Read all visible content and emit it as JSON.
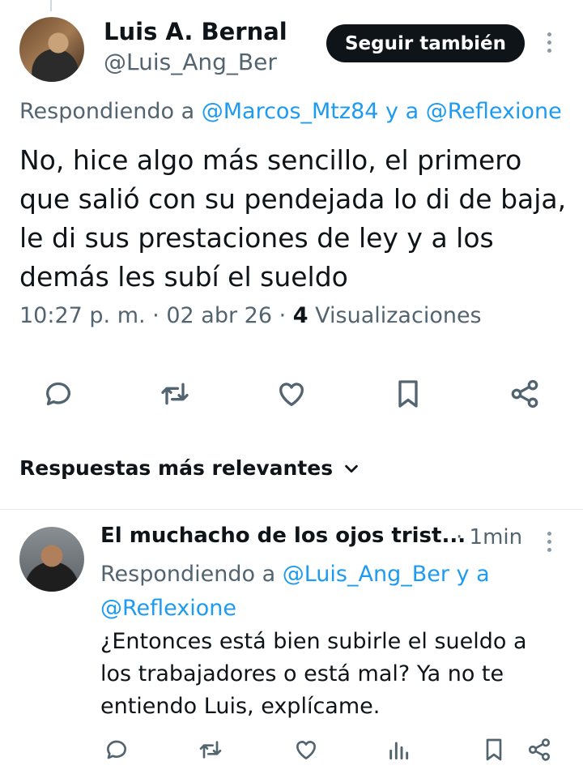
{
  "tweet": {
    "author_name": "Luis A. Bernal",
    "author_handle": "@Luis_Ang_Ber",
    "follow_label": "Seguir también",
    "replying_prefix": "Respondiendo a ",
    "replying_user1": "@Marcos_Mtz84",
    "replying_joiner": " y a ",
    "replying_user2": "@Reflexione",
    "text": "No, hice algo más sencillo, el primero que salió con su pendejada lo di de baja, le di sus prestaciones de ley y a los demás les subí el sueldo",
    "time": "10:27 p. m.",
    "date": "02 abr 26",
    "separator": " · ",
    "views_count": "4",
    "views_label": " Visualizaciones",
    "actions": [
      "reply-icon",
      "retweet-icon",
      "like-icon",
      "bookmark-icon",
      "share-icon"
    ]
  },
  "sort": {
    "label": "Respuestas más relevantes",
    "icon": "chevron-down-icon"
  },
  "reply": {
    "author_name": "El muchacho de los ojos trist...",
    "time": "· 1min",
    "replying_prefix": "Respondiendo a ",
    "replying_user1": "@Luis_Ang_Ber",
    "replying_joiner": " y a ",
    "replying_user2": "@Reflexione",
    "text": "¿Entonces está bien subirle el sueldo a los trabajadores o está mal? Ya no te entiendo Luis, explícame.",
    "actions": [
      "reply-icon",
      "retweet-icon",
      "like-icon",
      "views-icon",
      "bookmark-icon",
      "share-icon"
    ]
  },
  "colors": {
    "link": "#1d9bf0",
    "secondary_text": "#536471",
    "primary_text": "#0f1419",
    "button_bg": "#0f1419"
  }
}
